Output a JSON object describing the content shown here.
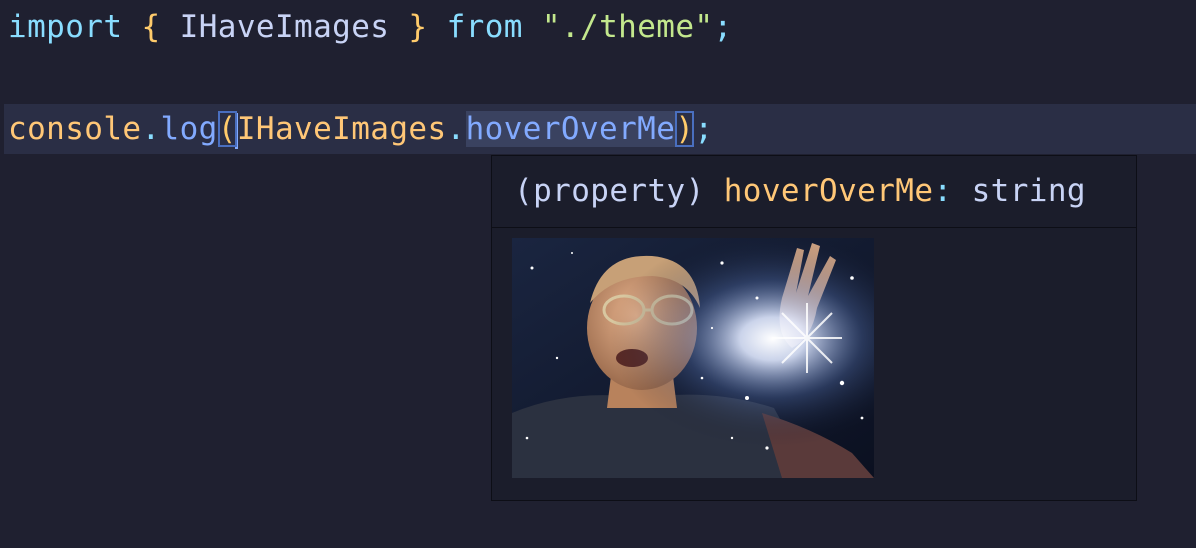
{
  "editor": {
    "line1": {
      "keyword_import": "import",
      "brace_open": "{",
      "identifier": "IHaveImages",
      "brace_close": "}",
      "keyword_from": "from",
      "string": "\"./theme\"",
      "semicolon": ";"
    },
    "line2": {
      "object": "console",
      "dot1": ".",
      "method": "log",
      "paren_open": "(",
      "identifier": "IHaveImages",
      "dot2": ".",
      "property": "hoverOverMe",
      "paren_close": ")",
      "semicolon": ";"
    }
  },
  "hover": {
    "kind": "(property)",
    "name": "hoverOverMe",
    "colon": ":",
    "type": "string",
    "image_icon": "gif-preview-image"
  },
  "colors": {
    "background": "#1f2030",
    "current_line": "#2a2e45",
    "keyword": "#89ddff",
    "string": "#c3e88d",
    "variable": "#ffc777",
    "function": "#82aaff",
    "hover_background": "#1b1d2b"
  }
}
